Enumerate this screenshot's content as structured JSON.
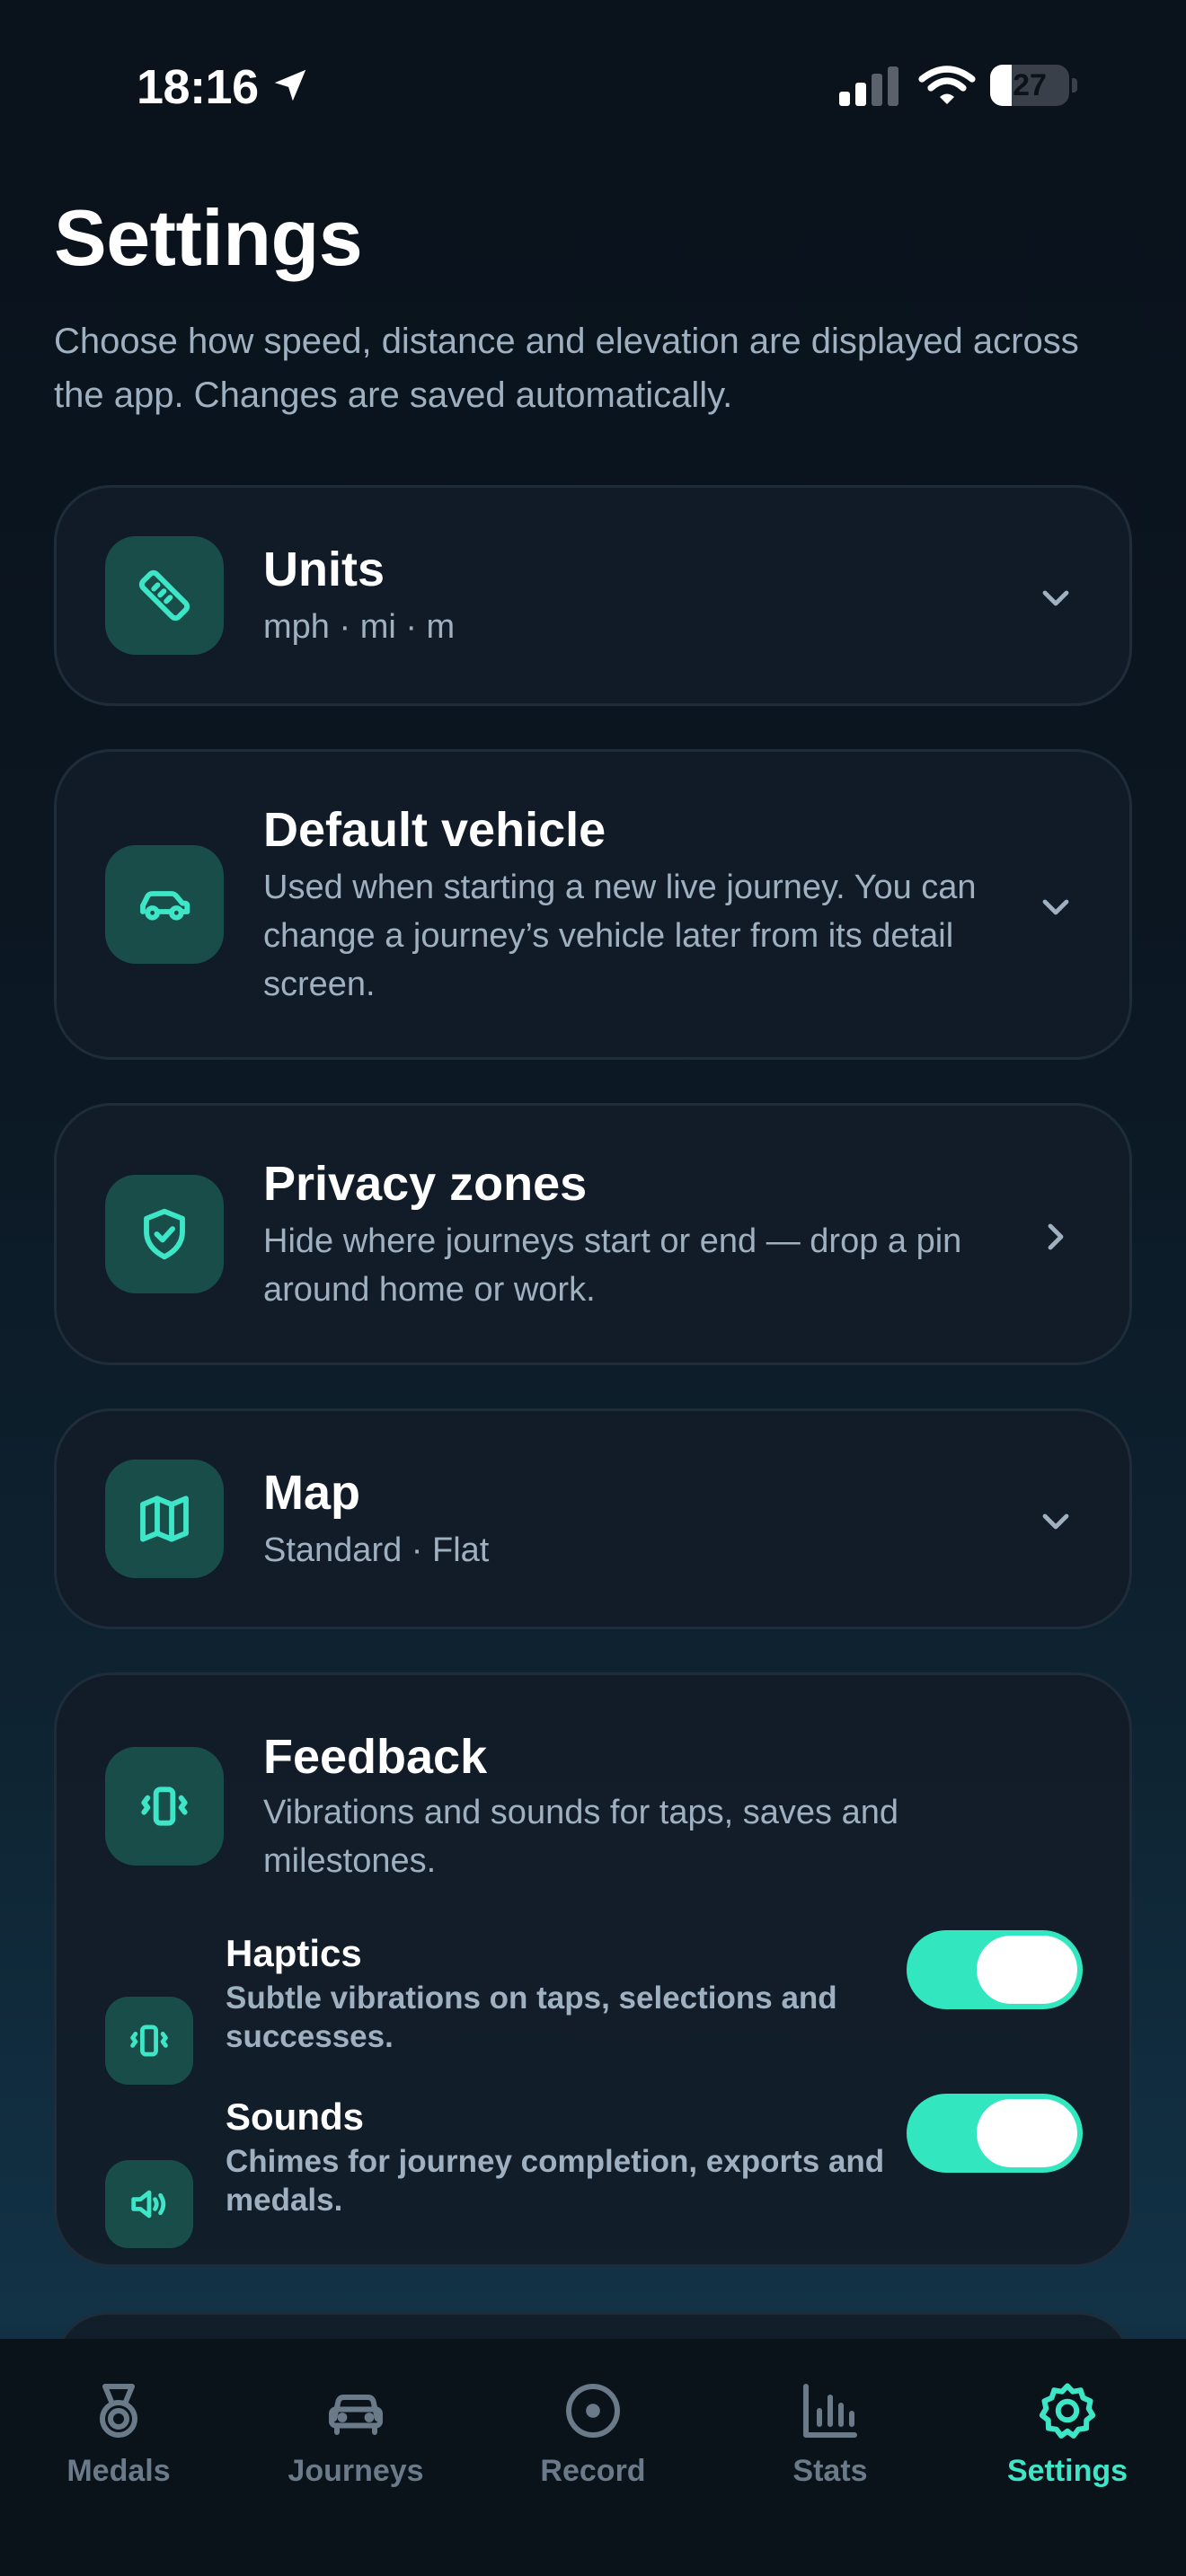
{
  "status_bar": {
    "time": "18:16",
    "battery": "27",
    "battery_level": 0.27
  },
  "header": {
    "title": "Settings",
    "subtitle": "Choose how speed, distance and elevation are displayed across the app. Changes are saved automatically."
  },
  "cards": {
    "units": {
      "title": "Units",
      "subtitle": "mph · mi · m",
      "icon": "ruler-icon"
    },
    "vehicle": {
      "title": "Default vehicle",
      "subtitle": "Used when starting a new live journey. You can change a journey’s vehicle later from its detail screen.",
      "icon": "car-icon"
    },
    "privacy": {
      "title": "Privacy zones",
      "subtitle": "Hide where journeys start or end — drop a pin around home or work.",
      "icon": "shield-check-icon"
    },
    "map": {
      "title": "Map",
      "subtitle": "Standard · Flat",
      "icon": "map-icon"
    },
    "feedback": {
      "title": "Feedback",
      "subtitle": "Vibrations and sounds for taps, saves and milestones.",
      "icon": "vibrate-icon",
      "rows": [
        {
          "title": "Haptics",
          "subtitle": "Subtle vibrations on taps, selections and successes.",
          "enabled": true,
          "icon": "vibrate-icon"
        },
        {
          "title": "Sounds",
          "subtitle": "Chimes for journey completion, exports and medals.",
          "enabled": true,
          "icon": "speaker-icon"
        }
      ]
    }
  },
  "tabs": [
    {
      "label": "Medals",
      "icon": "medal-icon",
      "active": false
    },
    {
      "label": "Journeys",
      "icon": "car-icon",
      "active": false
    },
    {
      "label": "Record",
      "icon": "record-icon",
      "active": false
    },
    {
      "label": "Stats",
      "icon": "bar-chart-icon",
      "active": false
    },
    {
      "label": "Settings",
      "icon": "gear-icon",
      "active": true
    }
  ],
  "colors": {
    "accent": "#3de6c6",
    "toggle_on": "#32e6c0",
    "icon_bg": "#194d4a",
    "muted_text": "#9fb0c1"
  }
}
